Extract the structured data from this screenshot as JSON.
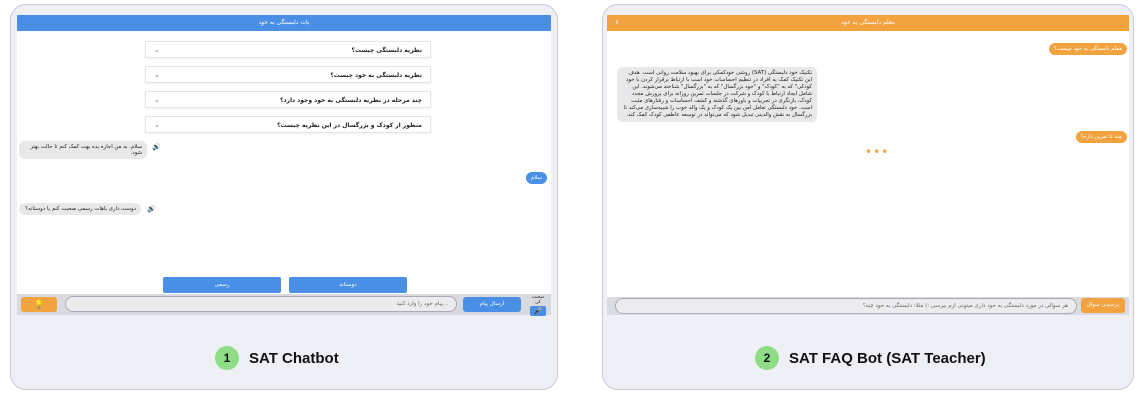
{
  "chatbot": {
    "header_title": "بات دلبستگی به خود",
    "faq_items": [
      "نظریه دلبستگی چیست؟",
      "نظریه دلبستگی به خود چیست؟",
      "چند مرحله در نظریه دلبستگی به خود وجود دارد؟",
      "منظور از کودک و بزرگسال در این نظریه چیست؟"
    ],
    "messages": [
      {
        "from": "bot",
        "text": "سلام. به من اجازه بده بهت کمک کنم تا حالت بهتر شود."
      },
      {
        "from": "user",
        "text": "سلام"
      },
      {
        "from": "bot",
        "text": "دوست داری باهات رسمی صحبت کنم یا دوستانه؟"
      }
    ],
    "choices": {
      "formal": "رسمی",
      "friendly": "دوستانه"
    },
    "input_placeholder": "...پیام خود را وارد کنید",
    "send_label": "ارسال پیام",
    "voice_label": "صحبت کن",
    "caption_number": "1",
    "caption_text": "SAT Chatbot"
  },
  "faqbot": {
    "header_title": "معلم دلبستگی به خود",
    "messages": [
      {
        "from": "user",
        "text": "معلم دلبستگی به خود چیست؟"
      },
      {
        "from": "bot",
        "text": "تکنیک خود دلبستگی (SAT) روشی خودکمکی برای بهبود سلامت روانی است. هدف این تکنیک کمک به افراد در تنظیم احساسات خود است با ارتباط برقرار کردن با خود کودکی\" که به \"کودک\" و \"خود بزرگسال\" که به \"بزرگسال\" شناخته می‌شوند. این شامل ایجاد ارتباط با کودک و شرکت در جلسات تمرین روزانه برای پرورش مجدد کودک، بازنگری در تجربیات و باورهای گذشته و کشف احساسات و رفتارهای مثبت است. خود دلبستگی تعامل امن بین یک کودک و یک والد خوب را شبیه‌سازی می‌کند تا بزرگسال به نقش والدینی تبدیل شود که می‌تواند در توسعه عاطفی کودک کمک کند."
      },
      {
        "from": "user",
        "text": "چند تا تمرین داره؟"
      }
    ],
    "typing_indicator": "•••",
    "input_placeholder": "هر سوالی در مورد دلبستگی به خود داری میتونی ازم بپرسی :) مثلا: دلبستگی به خود چیه؟",
    "submit_label": "پرسیدن سوال",
    "caption_number": "2",
    "caption_text": "SAT FAQ Bot (SAT Teacher)"
  },
  "icons": {
    "chevron": "⌄",
    "back": "‹",
    "speaker": "🔊",
    "mic": "🎤",
    "bulb": "💡"
  },
  "colors": {
    "blue": "#4a8fe6",
    "orange": "#f2a23f",
    "green_badge": "#8fdc86"
  }
}
